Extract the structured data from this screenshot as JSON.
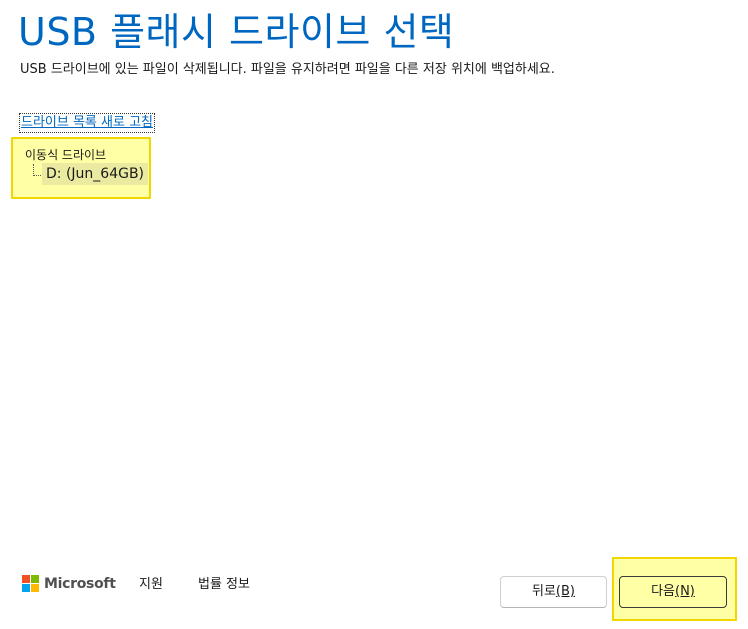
{
  "header": {
    "title": "USB 플래시 드라이브 선택",
    "subtitle": "USB 드라이브에 있는 파일이 삭제됩니다. 파일을 유지하려면 파일을 다른 저장 위치에 백업하세요."
  },
  "drives": {
    "refresh_label": "드라이브 목록 새로 고침",
    "group_label": "이동식 드라이브",
    "items": [
      {
        "label": "D: (Jun_64GB)",
        "selected": true
      }
    ]
  },
  "footer": {
    "brand": "Microsoft",
    "brand_colors": [
      "#f25022",
      "#7fba00",
      "#00a4ef",
      "#ffb900"
    ],
    "support_label": "지원",
    "legal_label": "법률 정보"
  },
  "buttons": {
    "back_label": "뒤로",
    "back_key": "(B)",
    "next_label": "다음",
    "next_key": "(N)"
  },
  "colors": {
    "accent": "#0067c0",
    "highlight": "#ffffa6",
    "highlight_border": "#f2d600"
  }
}
